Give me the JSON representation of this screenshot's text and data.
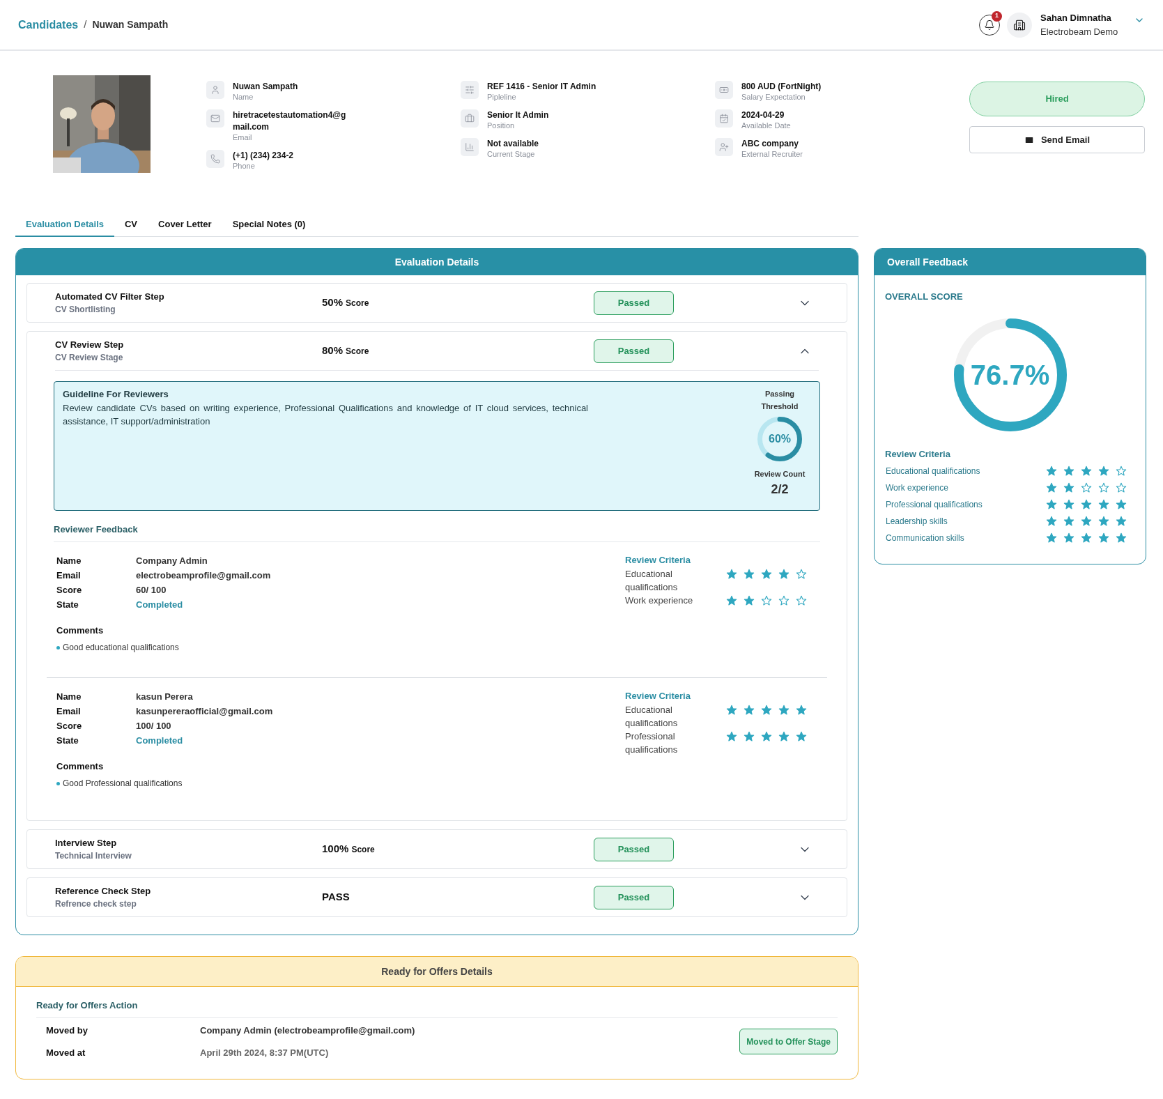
{
  "header": {
    "breadcrumb": [
      {
        "label": "Candidates"
      },
      {
        "label": "Nuwan Sampath"
      }
    ],
    "separator": "/",
    "notification_count": "1",
    "user_name": "Sahan Dimnatha",
    "organization": "Electrobeam Demo"
  },
  "profile": {
    "columns": [
      [
        {
          "value": "Nuwan Sampath",
          "label": "Name"
        },
        {
          "value": "hiretracetestautomation4@gmail.com",
          "label": "Email"
        },
        {
          "value": "(+1) (234) 234-2",
          "label": "Phone"
        }
      ],
      [
        {
          "value": "REF 1416 - Senior IT Admin",
          "label": "Pipleline"
        },
        {
          "value": "Senior It Admin",
          "label": "Position"
        },
        {
          "value": "Not available",
          "label": "Current Stage"
        }
      ],
      [
        {
          "value": "800 AUD (FortNight)",
          "label": "Salary Expectation"
        },
        {
          "value": "2024-04-29",
          "label": "Available Date"
        },
        {
          "value": "ABC company",
          "label": "External Recruiter"
        }
      ]
    ],
    "status": "Hired",
    "email_button": "Send Email"
  },
  "tabs": [
    {
      "label": "Evaluation Details",
      "selected": true
    },
    {
      "label": "CV",
      "selected": false
    },
    {
      "label": "Cover Letter",
      "selected": false
    },
    {
      "label": "Special Notes (0)",
      "selected": false
    }
  ],
  "evaluation": {
    "title": "Evaluation Details",
    "steps": [
      {
        "title": "Automated CV Filter Step",
        "subtitle": "CV Shortlisting",
        "score": "50%",
        "score_unit": "Score",
        "status": "Passed",
        "expanded": false
      },
      {
        "title": "CV Review Step",
        "subtitle": "CV Review Stage",
        "score": "80%",
        "score_unit": "Score",
        "status": "Passed",
        "expanded": true,
        "detail": {
          "guideline": {
            "title": "Guideline For Reviewers",
            "text": "Review candidate CVs based on writing experience, Professional Qualifications and knowledge of IT cloud services, technical assistance, IT support/administration",
            "threshold_label": "Passing Threshold",
            "threshold": "60%",
            "level": 0.6,
            "review_count_label": "Review Count",
            "review_count": "2/2"
          },
          "feedback_title": "Reviewer Feedback",
          "reviewers": [
            {
              "fields": [
                {
                  "label": "Name",
                  "value": "Company Admin",
                  "kind": "text"
                },
                {
                  "label": "Email",
                  "value": "electrobeamprofile@gmail.com",
                  "kind": "text"
                },
                {
                  "label": "Score",
                  "value": "60/ 100",
                  "kind": "text"
                },
                {
                  "label": "State",
                  "value": "Completed",
                  "kind": "status"
                }
              ],
              "comments_label": "Comments",
              "comments": [
                "Good educational qualifications"
              ],
              "criteria_title": "Review Criteria",
              "criteria": [
                {
                  "name": "Educational qualifications",
                  "stars": 4
                },
                {
                  "name": "Work experience",
                  "stars": 2
                }
              ]
            },
            {
              "fields": [
                {
                  "label": "Name",
                  "value": "kasun Perera",
                  "kind": "text"
                },
                {
                  "label": "Email",
                  "value": "kasunpereraofficial@gmail.com",
                  "kind": "text"
                },
                {
                  "label": "Score",
                  "value": "100/ 100",
                  "kind": "text"
                },
                {
                  "label": "State",
                  "value": "Completed",
                  "kind": "status"
                }
              ],
              "comments_label": "Comments",
              "comments": [
                "Good Professional qualifications"
              ],
              "criteria_title": "Review Criteria",
              "criteria": [
                {
                  "name": "Educational qualifications",
                  "stars": 5
                },
                {
                  "name": "Professional qualifications",
                  "stars": 5
                }
              ]
            }
          ]
        }
      },
      {
        "title": "Interview Step",
        "subtitle": "Technical Interview",
        "score": "100%",
        "score_unit": "Score",
        "status": "Passed",
        "expanded": false
      },
      {
        "title": "Reference Check Step",
        "subtitle": "Refrence check step",
        "score": "PASS",
        "status": "Passed",
        "expanded": false
      }
    ]
  },
  "overall": {
    "title": "Overall Feedback",
    "score_label": "OVERALL SCORE",
    "score": "76.7%",
    "level": 0.767,
    "criteria_title": "Review Criteria",
    "criteria": [
      {
        "name": "Educational qualifications",
        "stars": 4
      },
      {
        "name": "Work experience",
        "stars": 2
      },
      {
        "name": "Professional qualifications",
        "stars": 5
      },
      {
        "name": "Leadership skills",
        "stars": 5
      },
      {
        "name": "Communication skills",
        "stars": 5
      }
    ]
  },
  "offers": {
    "title": "Ready for Offers Details",
    "section_title": "Ready for Offers Action",
    "rows": [
      {
        "label": "Moved by",
        "value": "Company Admin (electrobeamprofile@gmail.com)"
      },
      {
        "label": "Moved at",
        "value": "April 29th 2024, 8:37 PM(UTC)"
      }
    ],
    "badge": "Moved to Offer Stage"
  }
}
